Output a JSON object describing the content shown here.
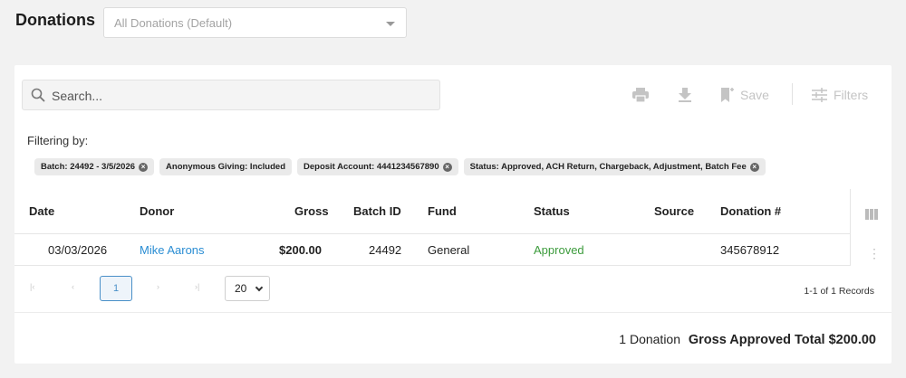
{
  "header": {
    "title": "Donations",
    "view_select": "All Donations (Default)"
  },
  "toolbar": {
    "search_placeholder": "Search...",
    "save_label": "Save",
    "filters_label": "Filters"
  },
  "filters": {
    "label": "Filtering by:",
    "chips": [
      "Batch: 24492 - 3/5/2026",
      "Anonymous Giving: Included",
      "Deposit Account: 4441234567890",
      "Status: Approved, ACH Return, Chargeback, Adjustment, Batch Fee"
    ]
  },
  "table": {
    "columns": [
      "Date",
      "Donor",
      "Gross",
      "Batch ID",
      "Fund",
      "Status",
      "Source",
      "Donation #"
    ],
    "rows": [
      {
        "date": "03/03/2026",
        "donor": "Mike Aarons",
        "gross": "$200.00",
        "batch_id": "24492",
        "fund": "General",
        "status": "Approved",
        "source": "",
        "donation_no": "345678912"
      }
    ]
  },
  "pagination": {
    "current_page": "1",
    "page_size": "20",
    "page_size_options": [
      "20"
    ],
    "records": "1-1 of 1 Records"
  },
  "summary": {
    "count": "1 Donation",
    "total": "Gross Approved Total $200.00"
  },
  "colors": {
    "link": "#2a8dd3",
    "approved": "#3c9b3c",
    "accent": "#4a90c8"
  }
}
